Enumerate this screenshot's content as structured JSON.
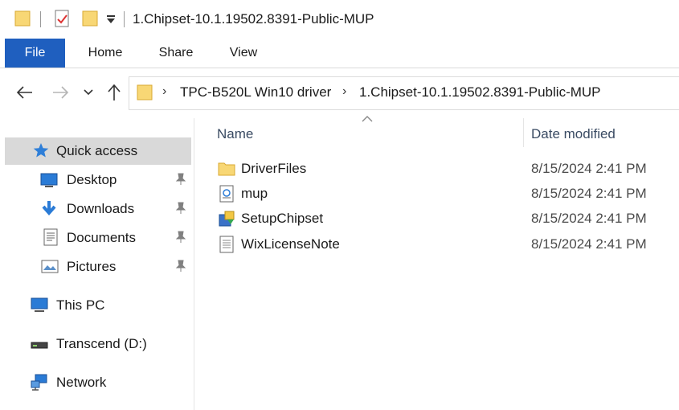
{
  "window": {
    "title": "1.Chipset-10.1.19502.8391-Public-MUP"
  },
  "ribbon": {
    "tabs": [
      {
        "label": "File"
      },
      {
        "label": "Home"
      },
      {
        "label": "Share"
      },
      {
        "label": "View"
      }
    ]
  },
  "navigation": {
    "back_icon": "arrow-left-icon",
    "forward_icon": "arrow-right-icon",
    "recent_icon": "chevron-down-icon",
    "up_icon": "arrow-up-icon"
  },
  "address": {
    "crumbs": [
      {
        "label": "TPC-B520L Win10 driver"
      },
      {
        "label": "1.Chipset-10.1.19502.8391-Public-MUP"
      }
    ]
  },
  "sidebar": {
    "items": [
      {
        "label": "Quick access",
        "icon": "star-icon",
        "selected": true
      },
      {
        "label": "Desktop",
        "icon": "desktop-icon",
        "pinned": true
      },
      {
        "label": "Downloads",
        "icon": "download-icon",
        "pinned": true
      },
      {
        "label": "Documents",
        "icon": "document-icon",
        "pinned": true
      },
      {
        "label": "Pictures",
        "icon": "picture-icon",
        "pinned": true
      },
      {
        "label": "This PC",
        "icon": "computer-icon"
      },
      {
        "label": "Transcend (D:)",
        "icon": "drive-icon"
      },
      {
        "label": "Network",
        "icon": "network-icon"
      }
    ]
  },
  "filelist": {
    "columns": {
      "name": "Name",
      "date": "Date modified"
    },
    "sort": {
      "column": "name",
      "direction": "ascending"
    },
    "rows": [
      {
        "name": "DriverFiles",
        "date": "8/15/2024 2:41 PM",
        "icon": "folder-icon"
      },
      {
        "name": "mup",
        "date": "8/15/2024 2:41 PM",
        "icon": "settings-file-icon"
      },
      {
        "name": "SetupChipset",
        "date": "8/15/2024 2:41 PM",
        "icon": "installer-icon"
      },
      {
        "name": "WixLicenseNote",
        "date": "8/15/2024 2:41 PM",
        "icon": "text-file-icon"
      }
    ]
  },
  "colors": {
    "accent": "#1f5fbf",
    "folder": "#f8d775",
    "selected_bg": "#d9d9d9"
  }
}
